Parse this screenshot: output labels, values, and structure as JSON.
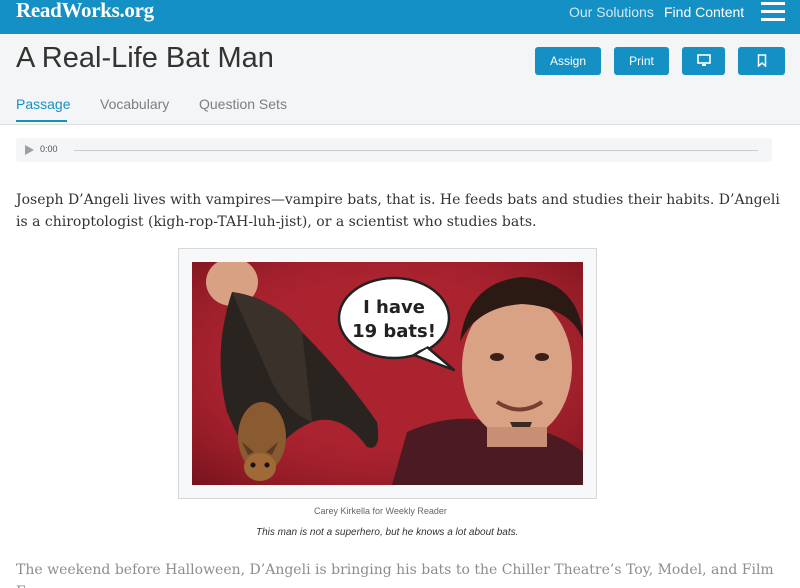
{
  "header": {
    "logo": "ReadWorks.org",
    "nav": [
      "Our Solutions",
      "Find Content"
    ]
  },
  "article": {
    "title": "A Real-Life Bat Man",
    "buttons": {
      "assign": "Assign",
      "print": "Print",
      "present_icon": "monitor-icon",
      "bookmark_icon": "bookmark-icon"
    },
    "tabs": [
      "Passage",
      "Vocabulary",
      "Question Sets"
    ],
    "active_tab": "Passage"
  },
  "audio": {
    "time": "0:00",
    "progress": 0
  },
  "passage": {
    "paragraph1": "Joseph D’Angeli lives with vampires—vampire bats, that is. He feeds bats and studies their habits. D’Angeli is a chiroptologist (kigh-rop-TAH-luh-jist), or a scientist who studies bats.",
    "paragraph2": "The weekend before Halloween, D’Angeli is bringing his bats to the Chiller Theatre’s Toy, Model, and Film Expo"
  },
  "figure": {
    "speech_bubble_line1": "I have",
    "speech_bubble_line2": "19 bats!",
    "credit": "Carey Kirkella for Weekly Reader",
    "caption": "This man is not a superhero, but he knows a lot about bats."
  },
  "colors": {
    "brand": "#1590c5",
    "photo_background": "#a51f2c"
  }
}
